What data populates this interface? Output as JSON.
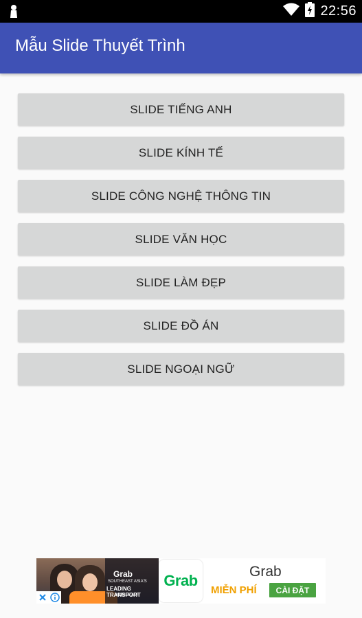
{
  "status_bar": {
    "time": "22:56",
    "icons": [
      "notification-icon",
      "wifi-icon",
      "battery-icon"
    ]
  },
  "app_bar": {
    "title": "Mẫu Slide Thuyết Trình",
    "color": "#3f51b5"
  },
  "buttons": [
    {
      "label": "SLIDE TIẾNG ANH"
    },
    {
      "label": "SLIDE KÍNH TẾ"
    },
    {
      "label": "SLIDE CÔNG NGHỆ THÔNG TIN"
    },
    {
      "label": "SLIDE VĂN HỌC"
    },
    {
      "label": "SLIDE LÀM ĐẸP"
    },
    {
      "label": "SLIDE ĐỒ ÁN"
    },
    {
      "label": "SLIDE NGOẠI NGỮ"
    }
  ],
  "ad": {
    "photo_brand": "Grab",
    "photo_line1": "SOUTHEAST ASIA'S",
    "photo_line2": "LEADING TRANSPORT",
    "photo_line3": "MOBILE APP",
    "logo_text": "Grab",
    "app_name": "Grab",
    "price": "MIỄN PHÍ",
    "install_label": "CÀI ĐẶT",
    "accent_color": "#00b14f"
  }
}
